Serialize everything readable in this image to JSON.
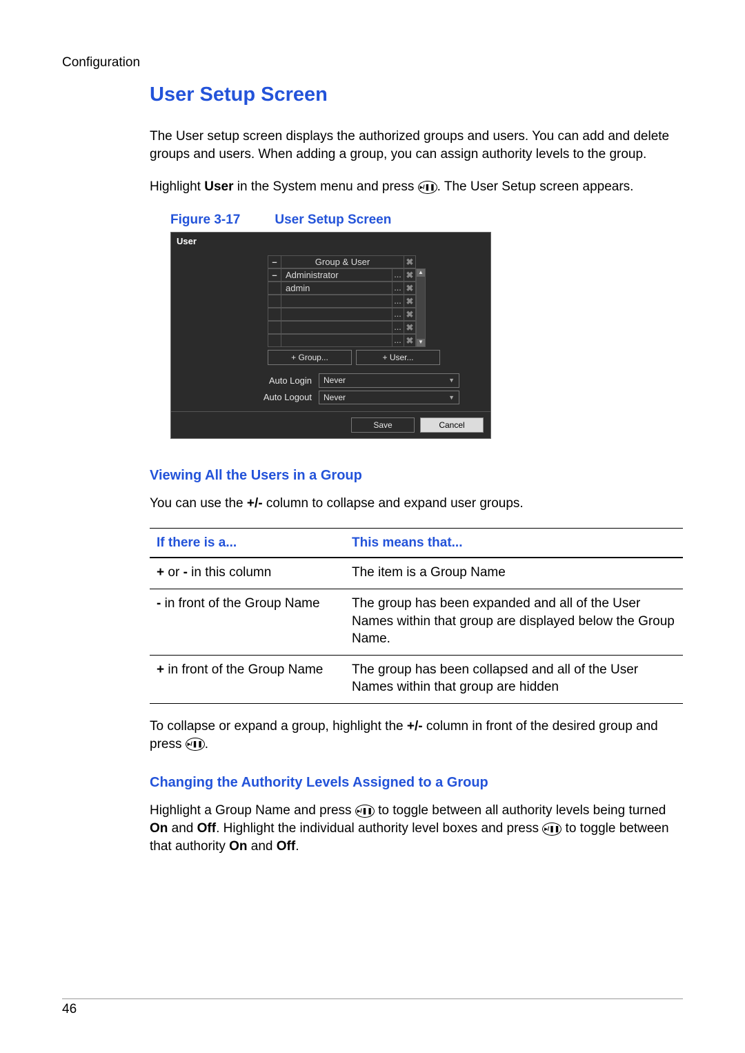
{
  "running_head": "Configuration",
  "page_number": "46",
  "h1": "User Setup Screen",
  "intro": "The User setup screen displays the authorized groups and users. You can add and delete groups and users. When adding a group, you can assign authority levels to the group.",
  "para2_a": "Highlight ",
  "para2_user": "User",
  "para2_b": " in the System menu and press ",
  "para2_c": ". The User Setup screen appears.",
  "key_glyph": "▸/❚❚",
  "figure": {
    "num": "Figure 3-17",
    "title": "User Setup Screen"
  },
  "dialog": {
    "title": "User",
    "rows": [
      {
        "coll": "–",
        "label": "Group & User",
        "centered": true,
        "dots": false,
        "x": true
      },
      {
        "coll": "–",
        "label": "Administrator",
        "centered": false,
        "dots": true,
        "x": true
      },
      {
        "coll": "",
        "label": "admin",
        "centered": false,
        "dots": true,
        "x": true
      },
      {
        "coll": "",
        "label": "",
        "centered": false,
        "dots": true,
        "x": true
      },
      {
        "coll": "",
        "label": "",
        "centered": false,
        "dots": true,
        "x": true
      },
      {
        "coll": "",
        "label": "",
        "centered": false,
        "dots": true,
        "x": true
      },
      {
        "coll": "",
        "label": "",
        "centered": false,
        "dots": true,
        "x": true
      }
    ],
    "add_group": "+ Group...",
    "add_user": "+ User...",
    "auto_login_k": "Auto Login",
    "auto_login_v": "Never",
    "auto_logout_k": "Auto Logout",
    "auto_logout_v": "Never",
    "save": "Save",
    "cancel": "Cancel"
  },
  "h2_view": "Viewing All the Users in a Group",
  "view_para_a": "You can use the ",
  "view_para_pm": "+/-",
  "view_para_b": " column to collapse and expand user groups.",
  "table": {
    "h1": "If there is a...",
    "h2": "This means that...",
    "rows": [
      {
        "c1_pre": "",
        "c1_b1": "+",
        "c1_mid": " or ",
        "c1_b2": "-",
        "c1_post": " in this column",
        "c2": "The item is a Group Name"
      },
      {
        "c1_pre": "",
        "c1_b1": "-",
        "c1_mid": "",
        "c1_b2": "",
        "c1_post": " in front of the Group Name",
        "c2": "The group has been expanded and all of the User Names within that group are displayed below the Group Name."
      },
      {
        "c1_pre": "",
        "c1_b1": "+",
        "c1_mid": "",
        "c1_b2": "",
        "c1_post": " in front of the Group Name",
        "c2": "The group has been collapsed and all of the User Names within that group are hidden"
      }
    ]
  },
  "collapse_para_a": "To collapse or expand a group, highlight the ",
  "collapse_para_pm": "+/-",
  "collapse_para_b": " column in front of the desired group and press ",
  "collapse_para_c": ".",
  "h2_change": "Changing the Authority Levels Assigned to a Group",
  "change_a": "Highlight a Group Name and press ",
  "change_b": " to toggle between all authority levels being turned ",
  "change_on": "On",
  "change_and1": " and ",
  "change_off": "Off",
  "change_c": ". Highlight the individual authority level boxes and press ",
  "change_d": " to toggle between that authority ",
  "change_e": "."
}
